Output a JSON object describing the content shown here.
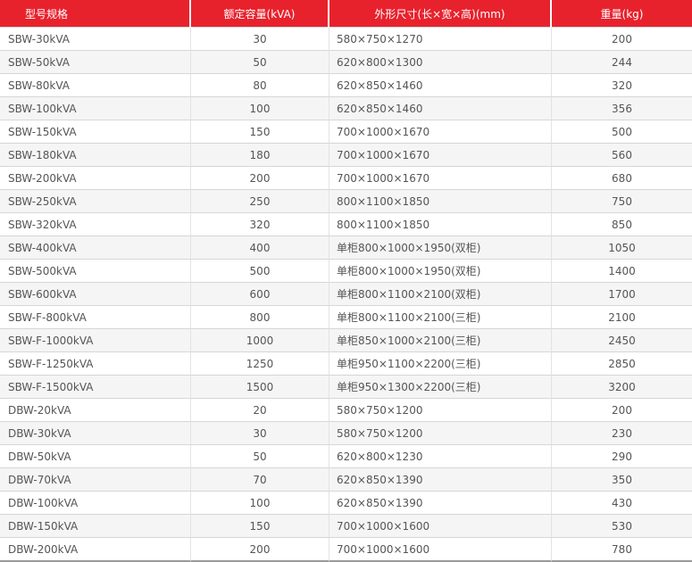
{
  "table": {
    "headers": {
      "model": "型号规格",
      "capacity": "额定容量(kVA)",
      "dimensions": "外形尺寸(长×宽×高)(mm)",
      "weight": "重量(kg)"
    },
    "rows": [
      {
        "model": "SBW-30kVA",
        "capacity": "30",
        "dimensions": "580×750×1270",
        "weight": "200"
      },
      {
        "model": "SBW-50kVA",
        "capacity": "50",
        "dimensions": "620×800×1300",
        "weight": "244"
      },
      {
        "model": "SBW-80kVA",
        "capacity": "80",
        "dimensions": "620×850×1460",
        "weight": "320"
      },
      {
        "model": "SBW-100kVA",
        "capacity": "100",
        "dimensions": "620×850×1460",
        "weight": "356"
      },
      {
        "model": "SBW-150kVA",
        "capacity": "150",
        "dimensions": "700×1000×1670",
        "weight": "500"
      },
      {
        "model": "SBW-180kVA",
        "capacity": "180",
        "dimensions": "700×1000×1670",
        "weight": "560"
      },
      {
        "model": "SBW-200kVA",
        "capacity": "200",
        "dimensions": "700×1000×1670",
        "weight": "680"
      },
      {
        "model": "SBW-250kVA",
        "capacity": "250",
        "dimensions": "800×1100×1850",
        "weight": "750"
      },
      {
        "model": "SBW-320kVA",
        "capacity": "320",
        "dimensions": "800×1100×1850",
        "weight": "850"
      },
      {
        "model": "SBW-400kVA",
        "capacity": "400",
        "dimensions": "单柜800×1000×1950(双柜)",
        "weight": "1050"
      },
      {
        "model": "SBW-500kVA",
        "capacity": "500",
        "dimensions": "单柜800×1000×1950(双柜)",
        "weight": "1400"
      },
      {
        "model": "SBW-600kVA",
        "capacity": "600",
        "dimensions": "单柜800×1100×2100(双柜)",
        "weight": "1700"
      },
      {
        "model": "SBW-F-800kVA",
        "capacity": "800",
        "dimensions": "单柜800×1100×2100(三柜)",
        "weight": "2100"
      },
      {
        "model": "SBW-F-1000kVA",
        "capacity": "1000",
        "dimensions": "单柜850×1000×2100(三柜)",
        "weight": "2450"
      },
      {
        "model": "SBW-F-1250kVA",
        "capacity": "1250",
        "dimensions": "单柜950×1100×2200(三柜)",
        "weight": "2850"
      },
      {
        "model": "SBW-F-1500kVA",
        "capacity": "1500",
        "dimensions": "单柜950×1300×2200(三柜)",
        "weight": "3200"
      },
      {
        "model": "DBW-20kVA",
        "capacity": "20",
        "dimensions": "580×750×1200",
        "weight": "200"
      },
      {
        "model": "DBW-30kVA",
        "capacity": "30",
        "dimensions": "580×750×1200",
        "weight": "230"
      },
      {
        "model": "DBW-50kVA",
        "capacity": "50",
        "dimensions": "620×800×1230",
        "weight": "290"
      },
      {
        "model": "DBW-70kVA",
        "capacity": "70",
        "dimensions": "620×850×1390",
        "weight": "350"
      },
      {
        "model": "DBW-100kVA",
        "capacity": "100",
        "dimensions": "620×850×1390",
        "weight": "430"
      },
      {
        "model": "DBW-150kVA",
        "capacity": "150",
        "dimensions": "700×1000×1600",
        "weight": "530"
      },
      {
        "model": "DBW-200kVA",
        "capacity": "200",
        "dimensions": "700×1000×1600",
        "weight": "780"
      }
    ]
  },
  "colors": {
    "header_background": "#e8222d",
    "header_text": "#ffffff",
    "body_text": "#555555",
    "stripe": "#f5f5f5"
  }
}
